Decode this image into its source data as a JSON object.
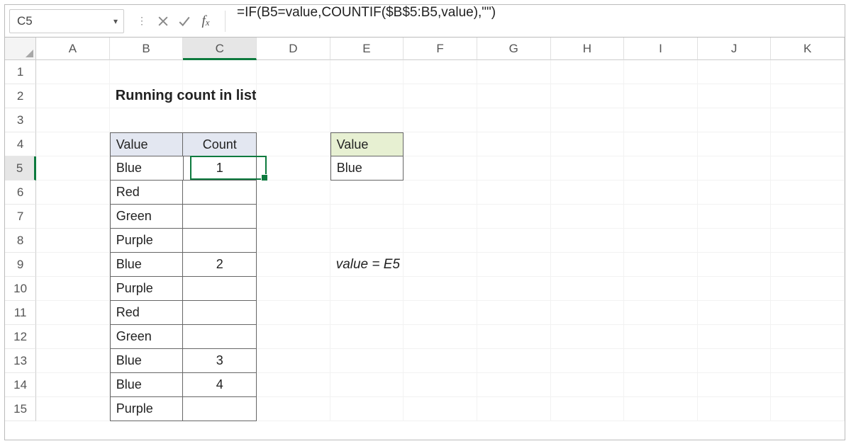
{
  "name_box": "C5",
  "formula": "=IF(B5=value,COUNTIF($B$5:B5,value),\"\")",
  "columns": [
    "A",
    "B",
    "C",
    "D",
    "E",
    "F",
    "G",
    "H",
    "I",
    "J",
    "K"
  ],
  "active_col_index": 2,
  "rows": [
    "1",
    "2",
    "3",
    "4",
    "5",
    "6",
    "7",
    "8",
    "9",
    "10",
    "11",
    "12",
    "13",
    "14",
    "15"
  ],
  "active_row_index": 4,
  "title": "Running count in list",
  "table": {
    "headers": {
      "value": "Value",
      "count": "Count"
    },
    "rows": [
      {
        "value": "Blue",
        "count": "1"
      },
      {
        "value": "Red",
        "count": ""
      },
      {
        "value": "Green",
        "count": ""
      },
      {
        "value": "Purple",
        "count": ""
      },
      {
        "value": "Blue",
        "count": "2"
      },
      {
        "value": "Purple",
        "count": ""
      },
      {
        "value": "Red",
        "count": ""
      },
      {
        "value": "Green",
        "count": ""
      },
      {
        "value": "Blue",
        "count": "3"
      },
      {
        "value": "Blue",
        "count": "4"
      },
      {
        "value": "Purple",
        "count": ""
      }
    ]
  },
  "lookup": {
    "header": "Value",
    "value": "Blue"
  },
  "note": "value = E5",
  "chart_data": {
    "type": "table",
    "title": "Running count in list",
    "columns": [
      "Value",
      "Count"
    ],
    "rows": [
      [
        "Blue",
        "1"
      ],
      [
        "Red",
        ""
      ],
      [
        "Green",
        ""
      ],
      [
        "Purple",
        ""
      ],
      [
        "Blue",
        "2"
      ],
      [
        "Purple",
        ""
      ],
      [
        "Red",
        ""
      ],
      [
        "Green",
        ""
      ],
      [
        "Blue",
        "3"
      ],
      [
        "Blue",
        "4"
      ],
      [
        "Purple",
        ""
      ]
    ],
    "lookup": {
      "header": "Value",
      "value": "Blue"
    },
    "formula": "=IF(B5=value,COUNTIF($B$5:B5,value),\"\")",
    "note": "value = E5"
  }
}
